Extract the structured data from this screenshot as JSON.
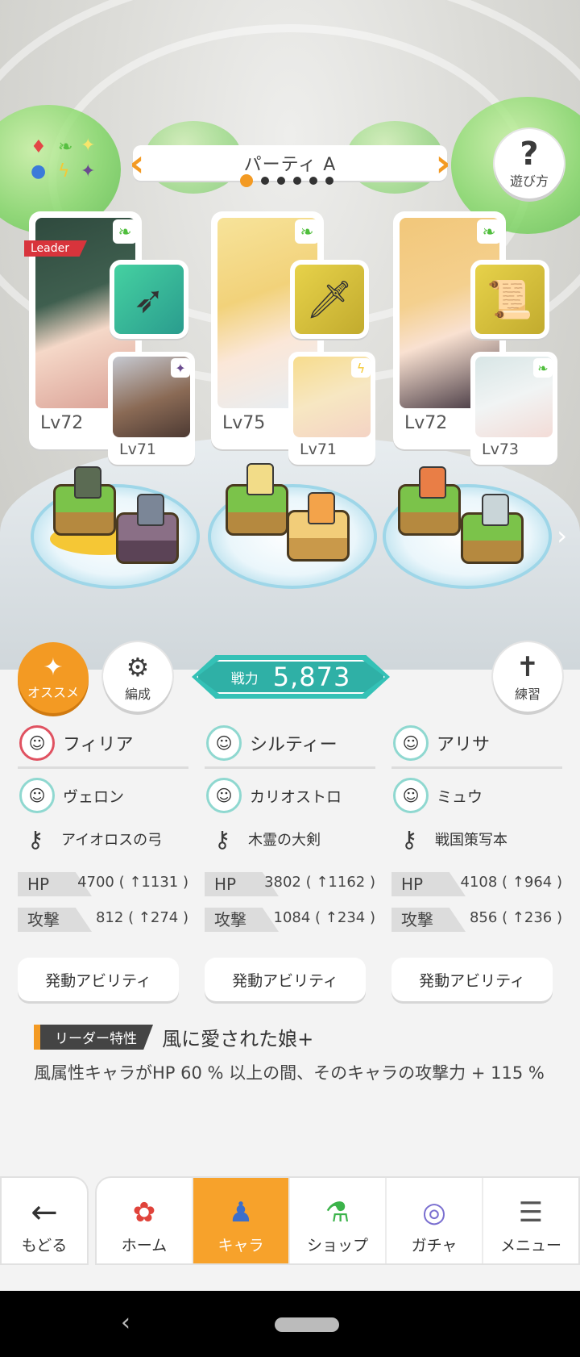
{
  "party": {
    "title": "パーティ A",
    "page_count": 6,
    "active_page": 1
  },
  "help_button": {
    "label": "遊び方",
    "icon": "question-icon"
  },
  "leader_label": "Leader",
  "teams": [
    {
      "main": {
        "level": "Lv72",
        "element": "wind",
        "name": "フィリア"
      },
      "weapon": {
        "name": "アイオロスの弓",
        "icon": "bow-icon",
        "bg": "#39c28f"
      },
      "sub": {
        "level": "Lv71",
        "element": "dark",
        "name": "ヴェロン"
      },
      "hp": "4700 ( ↑1131 )",
      "atk": "812 ( ↑274 )"
    },
    {
      "main": {
        "level": "Lv75",
        "element": "wind",
        "name": "シルティー"
      },
      "weapon": {
        "name": "木霊の大剣",
        "icon": "sword-icon",
        "bg": "#d9c53a"
      },
      "sub": {
        "level": "Lv71",
        "element": "light",
        "name": "カリオストロ"
      },
      "hp": "3802 ( ↑1162 )",
      "atk": "1084 ( ↑234 )"
    },
    {
      "main": {
        "level": "Lv72",
        "element": "wind",
        "name": "アリサ"
      },
      "weapon": {
        "name": "戦国策写本",
        "icon": "book-icon",
        "bg": "#d9c53a"
      },
      "sub": {
        "level": "Lv73",
        "element": "wind",
        "name": "ミュウ"
      },
      "hp": "4108 ( ↑964 )",
      "atk": "856 ( ↑236 )"
    }
  ],
  "power": {
    "label": "戦力",
    "value": "5,873"
  },
  "osusume_label": "オススメ",
  "hensei_label": "編成",
  "renshu_label": "練習",
  "stat_labels": {
    "hp": "HP",
    "atk": "攻撃"
  },
  "ability_button_label": "発動アビリティ",
  "leader_skill": {
    "tag": "リーダー特性",
    "name": "風に愛された娘+",
    "description": "風属性キャラがHP 60 % 以上の間、そのキャラの攻撃力 + 115 %"
  },
  "nav": {
    "back": "もどる",
    "tabs": [
      "ホーム",
      "キャラ",
      "ショップ",
      "ガチャ",
      "メニュー"
    ],
    "active_tab": "キャラ"
  },
  "colors": {
    "accent": "#f39a23",
    "power": "#34c1b6",
    "leader_red": "#d8343c"
  }
}
